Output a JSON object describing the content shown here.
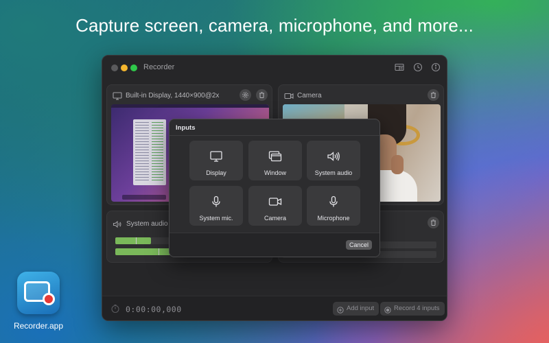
{
  "headline": "Capture screen, camera, microphone, and more...",
  "window": {
    "title": "Recorder",
    "toolbar_icons": [
      "sidebar-list-icon",
      "history-icon",
      "info-icon"
    ]
  },
  "panels": {
    "display": {
      "label": "Built-in Display, 1440×900@2x",
      "icon": "display-icon"
    },
    "camera": {
      "label": "Camera",
      "icon": "camera-icon"
    },
    "system_audio": {
      "label": "System audio",
      "icon": "speaker-icon",
      "meter_levels": [
        0.23,
        0.57
      ]
    }
  },
  "footer": {
    "timer": "0:00:00,000",
    "add_input": "Add input",
    "record": "Record 4 inputs"
  },
  "dialog": {
    "title": "Inputs",
    "tiles": [
      {
        "label": "Display",
        "icon": "display-icon"
      },
      {
        "label": "Window",
        "icon": "window-icon"
      },
      {
        "label": "System audio",
        "icon": "speaker-icon"
      },
      {
        "label": "System mic.",
        "icon": "microphone-icon"
      },
      {
        "label": "Camera",
        "icon": "camera-icon"
      },
      {
        "label": "Microphone",
        "icon": "microphone-icon"
      }
    ],
    "cancel": "Cancel"
  },
  "app": {
    "name": "Recorder.app"
  },
  "colors": {
    "accent_green": "#2fc84a",
    "meter_green": "#7ab85a",
    "record_red": "#e53935"
  }
}
